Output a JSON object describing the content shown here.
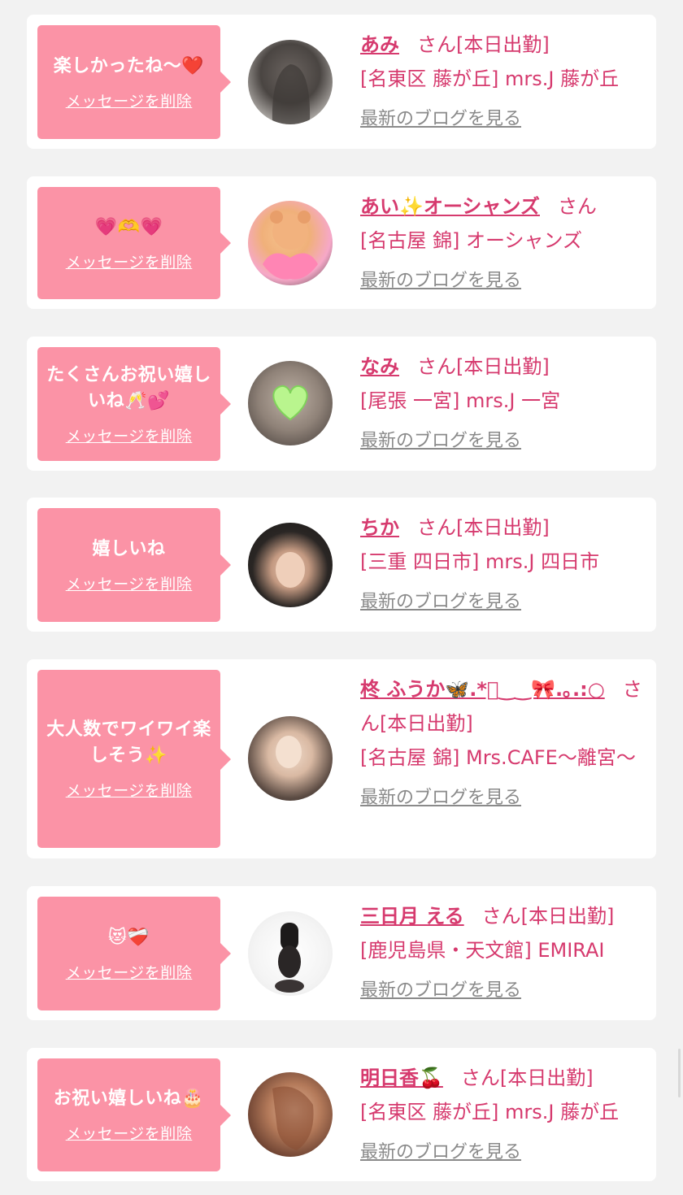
{
  "common": {
    "delete_label": "メッセージを削除",
    "blog_label": "最新のブログを見る",
    "san": "さん"
  },
  "items": [
    {
      "message": "楽しかったね〜❤️",
      "name": "あみ",
      "status": "[本日出勤]",
      "shop": "[名東区 藤が丘] mrs.J 藤が丘"
    },
    {
      "message": "💗🫶💗",
      "name": "あい✨オーシャンズ",
      "status": "",
      "shop": "[名古屋 錦] オーシャンズ"
    },
    {
      "message": "たくさんお祝い嬉しいね🥂💕",
      "name": "なみ",
      "status": "[本日出勤]",
      "shop": "[尾張 一宮] mrs.J 一宮"
    },
    {
      "message": "嬉しいね",
      "name": "ちか",
      "status": "[本日出勤]",
      "shop": "[三重 四日市] mrs.J 四日市"
    },
    {
      "message": "大人数でワイワイ楽しそう✨",
      "name": "柊 ふうか🦋.*ﾟ‿‿🎀.｡.:○",
      "status": "[本日出勤]",
      "shop": "[名古屋 錦] Mrs.CAFE〜離宮〜"
    },
    {
      "message": "😻❤️‍🩹",
      "name": "三日月 える",
      "status": "[本日出勤]",
      "shop": "[鹿児島県・天文館] EMIRAI"
    },
    {
      "message": "お祝い嬉しいね🎂",
      "name": "明日香🍒",
      "status": "[本日出勤]",
      "shop": "[名東区 藤が丘] mrs.J 藤が丘"
    }
  ]
}
